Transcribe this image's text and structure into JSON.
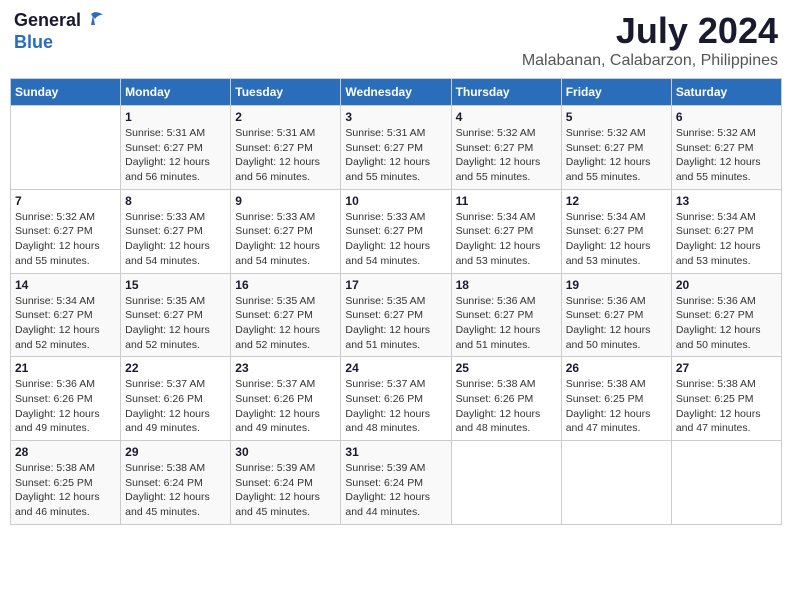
{
  "logo": {
    "general": "General",
    "blue": "Blue"
  },
  "title": "July 2024",
  "subtitle": "Malabanan, Calabarzon, Philippines",
  "weekdays": [
    "Sunday",
    "Monday",
    "Tuesday",
    "Wednesday",
    "Thursday",
    "Friday",
    "Saturday"
  ],
  "weeks": [
    [
      {
        "day": "",
        "sunrise": "",
        "sunset": "",
        "daylight": ""
      },
      {
        "day": "1",
        "sunrise": "Sunrise: 5:31 AM",
        "sunset": "Sunset: 6:27 PM",
        "daylight": "Daylight: 12 hours and 56 minutes."
      },
      {
        "day": "2",
        "sunrise": "Sunrise: 5:31 AM",
        "sunset": "Sunset: 6:27 PM",
        "daylight": "Daylight: 12 hours and 56 minutes."
      },
      {
        "day": "3",
        "sunrise": "Sunrise: 5:31 AM",
        "sunset": "Sunset: 6:27 PM",
        "daylight": "Daylight: 12 hours and 55 minutes."
      },
      {
        "day": "4",
        "sunrise": "Sunrise: 5:32 AM",
        "sunset": "Sunset: 6:27 PM",
        "daylight": "Daylight: 12 hours and 55 minutes."
      },
      {
        "day": "5",
        "sunrise": "Sunrise: 5:32 AM",
        "sunset": "Sunset: 6:27 PM",
        "daylight": "Daylight: 12 hours and 55 minutes."
      },
      {
        "day": "6",
        "sunrise": "Sunrise: 5:32 AM",
        "sunset": "Sunset: 6:27 PM",
        "daylight": "Daylight: 12 hours and 55 minutes."
      }
    ],
    [
      {
        "day": "7",
        "sunrise": "Sunrise: 5:32 AM",
        "sunset": "Sunset: 6:27 PM",
        "daylight": "Daylight: 12 hours and 55 minutes."
      },
      {
        "day": "8",
        "sunrise": "Sunrise: 5:33 AM",
        "sunset": "Sunset: 6:27 PM",
        "daylight": "Daylight: 12 hours and 54 minutes."
      },
      {
        "day": "9",
        "sunrise": "Sunrise: 5:33 AM",
        "sunset": "Sunset: 6:27 PM",
        "daylight": "Daylight: 12 hours and 54 minutes."
      },
      {
        "day": "10",
        "sunrise": "Sunrise: 5:33 AM",
        "sunset": "Sunset: 6:27 PM",
        "daylight": "Daylight: 12 hours and 54 minutes."
      },
      {
        "day": "11",
        "sunrise": "Sunrise: 5:34 AM",
        "sunset": "Sunset: 6:27 PM",
        "daylight": "Daylight: 12 hours and 53 minutes."
      },
      {
        "day": "12",
        "sunrise": "Sunrise: 5:34 AM",
        "sunset": "Sunset: 6:27 PM",
        "daylight": "Daylight: 12 hours and 53 minutes."
      },
      {
        "day": "13",
        "sunrise": "Sunrise: 5:34 AM",
        "sunset": "Sunset: 6:27 PM",
        "daylight": "Daylight: 12 hours and 53 minutes."
      }
    ],
    [
      {
        "day": "14",
        "sunrise": "Sunrise: 5:34 AM",
        "sunset": "Sunset: 6:27 PM",
        "daylight": "Daylight: 12 hours and 52 minutes."
      },
      {
        "day": "15",
        "sunrise": "Sunrise: 5:35 AM",
        "sunset": "Sunset: 6:27 PM",
        "daylight": "Daylight: 12 hours and 52 minutes."
      },
      {
        "day": "16",
        "sunrise": "Sunrise: 5:35 AM",
        "sunset": "Sunset: 6:27 PM",
        "daylight": "Daylight: 12 hours and 52 minutes."
      },
      {
        "day": "17",
        "sunrise": "Sunrise: 5:35 AM",
        "sunset": "Sunset: 6:27 PM",
        "daylight": "Daylight: 12 hours and 51 minutes."
      },
      {
        "day": "18",
        "sunrise": "Sunrise: 5:36 AM",
        "sunset": "Sunset: 6:27 PM",
        "daylight": "Daylight: 12 hours and 51 minutes."
      },
      {
        "day": "19",
        "sunrise": "Sunrise: 5:36 AM",
        "sunset": "Sunset: 6:27 PM",
        "daylight": "Daylight: 12 hours and 50 minutes."
      },
      {
        "day": "20",
        "sunrise": "Sunrise: 5:36 AM",
        "sunset": "Sunset: 6:27 PM",
        "daylight": "Daylight: 12 hours and 50 minutes."
      }
    ],
    [
      {
        "day": "21",
        "sunrise": "Sunrise: 5:36 AM",
        "sunset": "Sunset: 6:26 PM",
        "daylight": "Daylight: 12 hours and 49 minutes."
      },
      {
        "day": "22",
        "sunrise": "Sunrise: 5:37 AM",
        "sunset": "Sunset: 6:26 PM",
        "daylight": "Daylight: 12 hours and 49 minutes."
      },
      {
        "day": "23",
        "sunrise": "Sunrise: 5:37 AM",
        "sunset": "Sunset: 6:26 PM",
        "daylight": "Daylight: 12 hours and 49 minutes."
      },
      {
        "day": "24",
        "sunrise": "Sunrise: 5:37 AM",
        "sunset": "Sunset: 6:26 PM",
        "daylight": "Daylight: 12 hours and 48 minutes."
      },
      {
        "day": "25",
        "sunrise": "Sunrise: 5:38 AM",
        "sunset": "Sunset: 6:26 PM",
        "daylight": "Daylight: 12 hours and 48 minutes."
      },
      {
        "day": "26",
        "sunrise": "Sunrise: 5:38 AM",
        "sunset": "Sunset: 6:25 PM",
        "daylight": "Daylight: 12 hours and 47 minutes."
      },
      {
        "day": "27",
        "sunrise": "Sunrise: 5:38 AM",
        "sunset": "Sunset: 6:25 PM",
        "daylight": "Daylight: 12 hours and 47 minutes."
      }
    ],
    [
      {
        "day": "28",
        "sunrise": "Sunrise: 5:38 AM",
        "sunset": "Sunset: 6:25 PM",
        "daylight": "Daylight: 12 hours and 46 minutes."
      },
      {
        "day": "29",
        "sunrise": "Sunrise: 5:38 AM",
        "sunset": "Sunset: 6:24 PM",
        "daylight": "Daylight: 12 hours and 45 minutes."
      },
      {
        "day": "30",
        "sunrise": "Sunrise: 5:39 AM",
        "sunset": "Sunset: 6:24 PM",
        "daylight": "Daylight: 12 hours and 45 minutes."
      },
      {
        "day": "31",
        "sunrise": "Sunrise: 5:39 AM",
        "sunset": "Sunset: 6:24 PM",
        "daylight": "Daylight: 12 hours and 44 minutes."
      },
      {
        "day": "",
        "sunrise": "",
        "sunset": "",
        "daylight": ""
      },
      {
        "day": "",
        "sunrise": "",
        "sunset": "",
        "daylight": ""
      },
      {
        "day": "",
        "sunrise": "",
        "sunset": "",
        "daylight": ""
      }
    ]
  ]
}
